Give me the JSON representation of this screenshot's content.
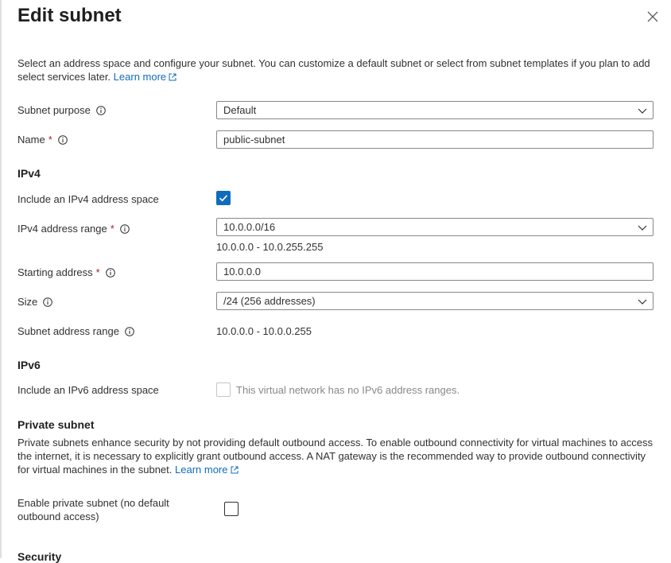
{
  "panel": {
    "title": "Edit subnet",
    "close_label": "Close"
  },
  "intro": {
    "text": "Select an address space and configure your subnet. You can customize a default subnet or select from subnet templates if you plan to add select services later.",
    "learn_more": "Learn more"
  },
  "subnet_purpose": {
    "label": "Subnet purpose",
    "value": "Default"
  },
  "name": {
    "label": "Name",
    "required_mark": "*",
    "value": "public-subnet"
  },
  "ipv4": {
    "heading": "IPv4",
    "include_label": "Include an IPv4 address space",
    "include_checked": true,
    "range_label": "IPv4 address range",
    "required_mark": "*",
    "range_value": "10.0.0.0/16",
    "range_hint": "10.0.0.0 - 10.0.255.255",
    "start_label": "Starting address",
    "start_value": "10.0.0.0",
    "size_label": "Size",
    "size_value": "/24 (256 addresses)",
    "subnet_range_label": "Subnet address range",
    "subnet_range_value": "10.0.0.0 - 10.0.0.255"
  },
  "ipv6": {
    "heading": "IPv6",
    "include_label": "Include an IPv6 address space",
    "include_checked": false,
    "disabled_note": "This virtual network has no IPv6 address ranges."
  },
  "private_subnet": {
    "heading": "Private subnet",
    "text": "Private subnets enhance security by not providing default outbound access. To enable outbound connectivity for virtual machines to access the internet, it is necessary to explicitly grant outbound access. A NAT gateway is the recommended way to provide outbound connectivity for virtual machines in the subnet.",
    "learn_more": "Learn more",
    "enable_label": "Enable private subnet (no default outbound access)",
    "enable_checked": false
  },
  "security": {
    "heading": "Security"
  },
  "colors": {
    "accent": "#0f6cbd",
    "text": "#323130",
    "border": "#8a8886",
    "required": "#a4262c",
    "disabled": "#8a8886"
  },
  "icons": [
    "close-icon",
    "info-icon",
    "external-link-icon",
    "chevron-down-icon",
    "checkmark-icon"
  ]
}
